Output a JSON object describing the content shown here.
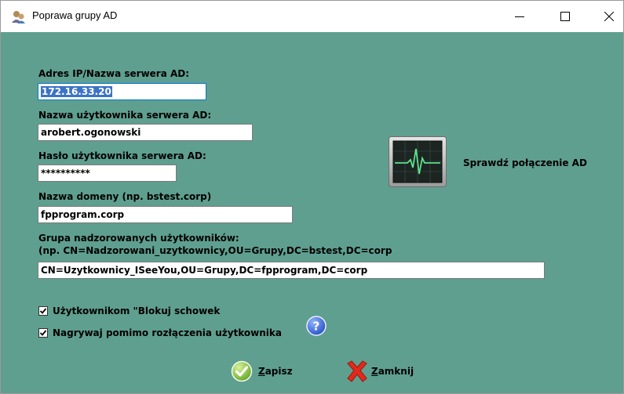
{
  "window": {
    "title": "Poprawa grupy AD"
  },
  "form": {
    "server_label": "Adres IP/Nazwa serwera AD:",
    "server_value": "172.16.33.20",
    "user_label": "Nazwa użytkownika serwera AD:",
    "user_value": "arobert.ogonowski",
    "password_label": "Hasło użytkownika serwera AD:",
    "password_value": "**********",
    "domain_label": "Nazwa domeny (np. bstest.corp)",
    "domain_value": "fpprogram.corp",
    "group_label_line1": "Grupa nadzorowanych użytkowników:",
    "group_label_line2": "(np. CN=Nadzorowani_uzytkownicy,OU=Grupy,DC=bstest,DC=corp",
    "group_value": "CN=Uzytkownicy_ISeeYou,OU=Grupy,DC=fpprogram,DC=corp"
  },
  "test_connection": {
    "label": "Sprawdź połączenie AD",
    "icon": "heartbeat-monitor-icon"
  },
  "options": {
    "block_clipboard_label": "Użytkownikom \"Blokuj schowek",
    "block_clipboard_checked": true,
    "record_label": "Nagrywaj pomimo rozłączenia użytkownika",
    "record_checked": true
  },
  "actions": {
    "save_accel": "Z",
    "save_rest": "apisz",
    "close_accel": "Z",
    "close_rest": "amknij"
  },
  "colors": {
    "client_background": "#5f9f8f",
    "selection": "#3b73c6",
    "focus_border": "#0078d7"
  }
}
